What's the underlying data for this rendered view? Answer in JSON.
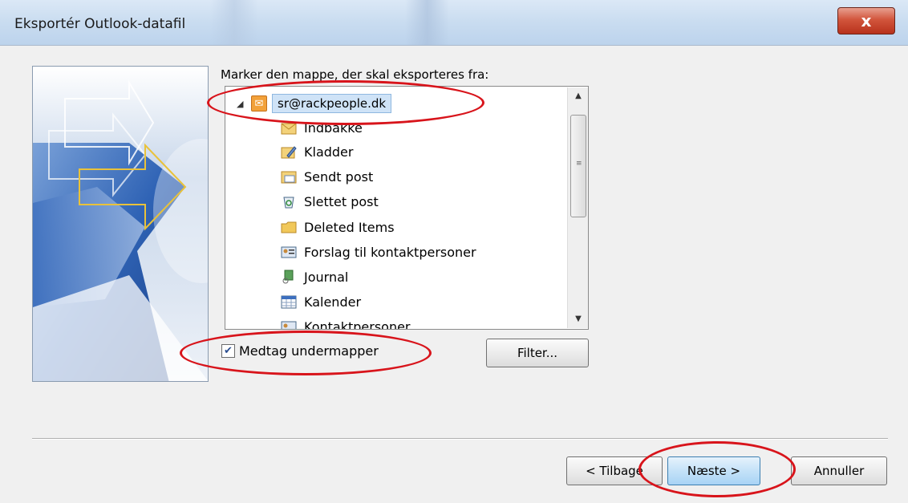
{
  "window": {
    "title": "Eksportér Outlook-datafil",
    "close_label": "x"
  },
  "prompt": "Marker den mappe, der skal eksporteres fra:",
  "tree": {
    "root": {
      "label": "sr@rackpeople.dk",
      "icon": "mailbox-icon"
    },
    "items": [
      {
        "label": "Indbakke",
        "icon": "inbox-icon"
      },
      {
        "label": "Kladder",
        "icon": "drafts-icon"
      },
      {
        "label": "Sendt post",
        "icon": "sent-icon"
      },
      {
        "label": "Slettet post",
        "icon": "deleted-icon"
      },
      {
        "label": "Deleted Items",
        "icon": "folder-icon"
      },
      {
        "label": "Forslag til kontaktpersoner",
        "icon": "contacts-icon"
      },
      {
        "label": "Journal",
        "icon": "journal-icon"
      },
      {
        "label": "Kalender",
        "icon": "calendar-icon"
      },
      {
        "label": "Kontaktpersoner",
        "icon": "contacts-icon"
      }
    ]
  },
  "checkbox": {
    "label": "Medtag undermapper",
    "checked": true
  },
  "buttons": {
    "filter": "Filter...",
    "back": "< Tilbage",
    "next": "Næste >",
    "cancel": "Annuller"
  },
  "colors": {
    "annotation": "#d8141b",
    "selection": "#cfe3f7"
  }
}
